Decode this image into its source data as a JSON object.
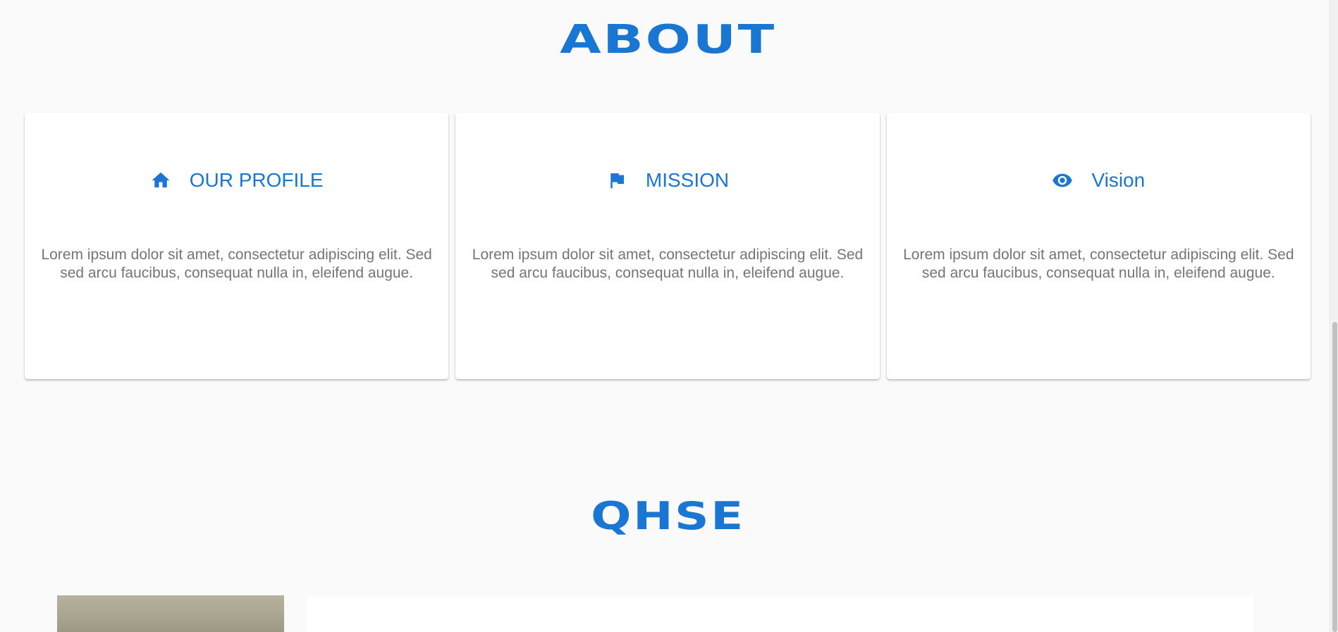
{
  "about": {
    "title": "ABOUT"
  },
  "cards": [
    {
      "icon": "home-icon",
      "title": "OUR PROFILE",
      "text": "Lorem ipsum dolor sit amet, consectetur adipiscing elit. Sed sed arcu faucibus, consequat nulla in, eleifend augue."
    },
    {
      "icon": "flag-icon",
      "title": "MISSION",
      "text": "Lorem ipsum dolor sit amet, consectetur adipiscing elit. Sed sed arcu faucibus, consequat nulla in, eleifend augue."
    },
    {
      "icon": "eye-icon",
      "title": "Vision",
      "text": "Lorem ipsum dolor sit amet, consectetur adipiscing elit. Sed sed arcu faucibus, consequat nulla in, eleifend augue."
    }
  ],
  "qhse": {
    "title": "QHSE"
  },
  "colors": {
    "accent": "#1976d2",
    "body_text": "#757575",
    "background": "#fafafa",
    "card": "#ffffff"
  }
}
